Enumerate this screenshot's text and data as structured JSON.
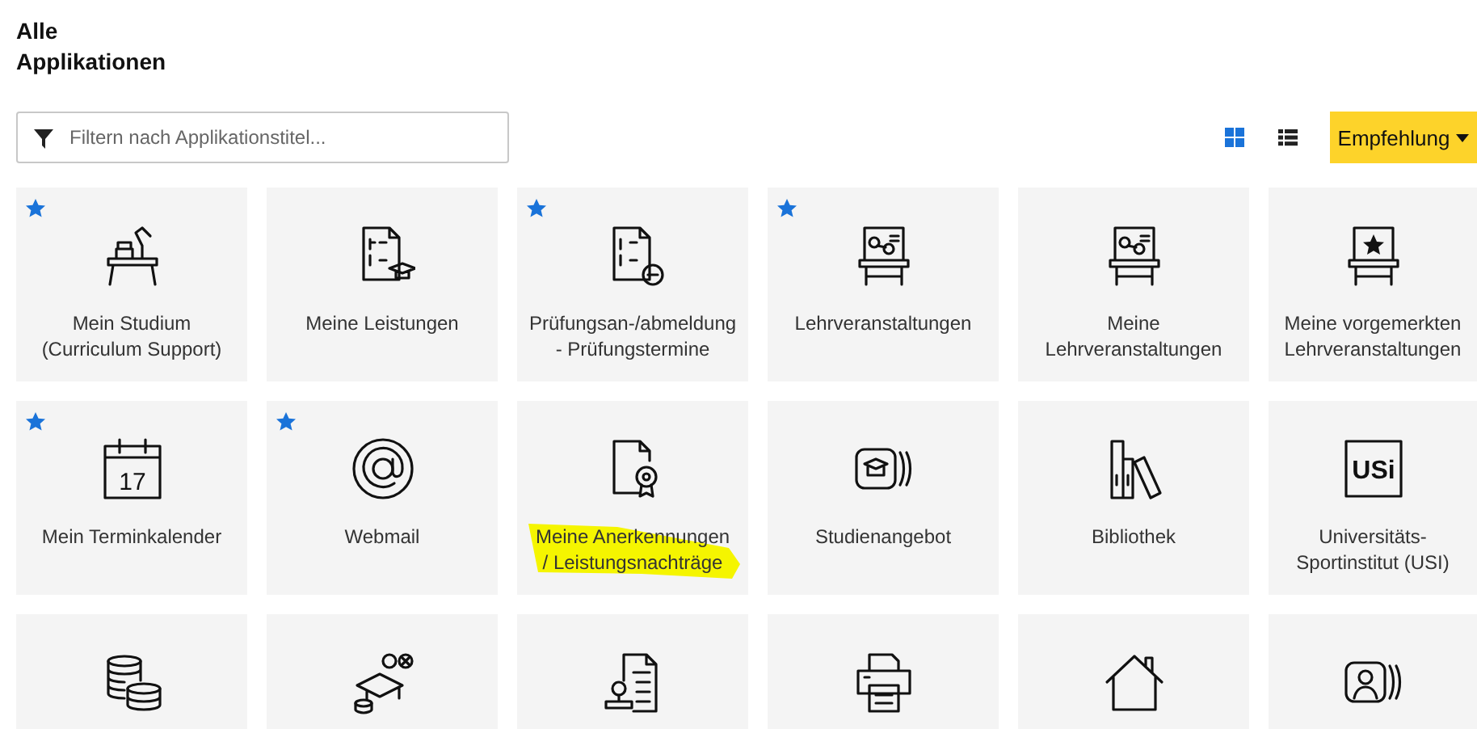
{
  "header": {
    "title_line_1": "Alle",
    "title_line_2": "Applikationen"
  },
  "filter": {
    "placeholder": "Filtern nach Applikationstitel..."
  },
  "view_toggle": [
    {
      "kind": "grid",
      "selected": true
    },
    {
      "kind": "list",
      "selected": false
    }
  ],
  "sort_button": {
    "label": "Empfehlung"
  },
  "tiles": [
    {
      "label_lines": [
        "Mein Studium",
        "(Curriculum Support)"
      ],
      "favorite": true,
      "highlighted": false
    },
    {
      "label_lines": [
        "Meine Leistungen"
      ],
      "favorite": false,
      "highlighted": false
    },
    {
      "label_lines": [
        "Prüfungsan-/abmeldung",
        "- Prüfungstermine"
      ],
      "favorite": true,
      "highlighted": false
    },
    {
      "label_lines": [
        "Lehrveranstaltungen"
      ],
      "favorite": true,
      "highlighted": false
    },
    {
      "label_lines": [
        "Meine",
        "Lehrveranstaltungen"
      ],
      "favorite": false,
      "highlighted": false
    },
    {
      "label_lines": [
        "Meine vorgemerkten",
        "Lehrveranstaltungen"
      ],
      "favorite": false,
      "highlighted": false
    },
    {
      "label_lines": [
        "Mein Terminkalender"
      ],
      "favorite": true,
      "highlighted": false,
      "icon_text": "17"
    },
    {
      "label_lines": [
        "Webmail"
      ],
      "favorite": true,
      "highlighted": false
    },
    {
      "label_lines": [
        "Meine Anerkennungen",
        "/ Leistungsnachträge"
      ],
      "favorite": false,
      "highlighted": true
    },
    {
      "label_lines": [
        "Studienangebot"
      ],
      "favorite": false,
      "highlighted": false
    },
    {
      "label_lines": [
        "Bibliothek"
      ],
      "favorite": false,
      "highlighted": false
    },
    {
      "label_lines": [
        "Universitäts-",
        "Sportinstitut (USI)"
      ],
      "favorite": false,
      "highlighted": false,
      "icon_text": "USi"
    },
    {
      "favorite": false,
      "highlighted": false
    },
    {
      "favorite": false,
      "highlighted": false
    },
    {
      "favorite": false,
      "highlighted": false
    },
    {
      "favorite": false,
      "highlighted": false
    },
    {
      "favorite": false,
      "highlighted": false
    },
    {
      "favorite": false,
      "highlighted": false
    }
  ]
}
